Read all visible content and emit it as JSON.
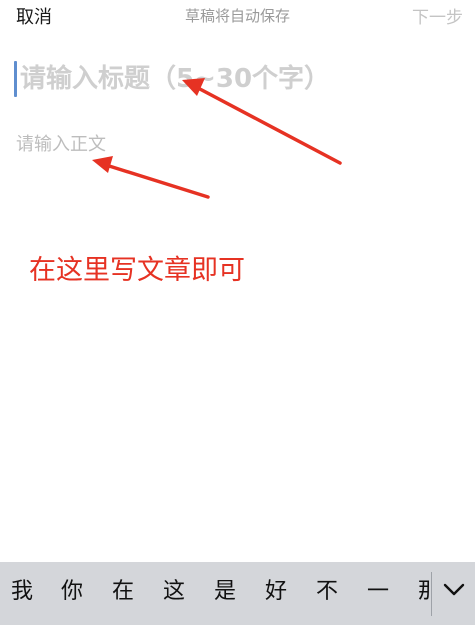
{
  "navbar": {
    "cancel_label": "取消",
    "status_text": "草稿将自动保存",
    "next_label": "下一步"
  },
  "editor": {
    "title_placeholder": "请输入标题（5~30个字）",
    "body_placeholder": "请输入正文"
  },
  "annotation": {
    "text": "在这里写文章即可",
    "color": "#e63223"
  },
  "keyboard": {
    "candidates": [
      "我",
      "你",
      "在",
      "这",
      "是",
      "好",
      "不",
      "一",
      "那"
    ],
    "collapse_icon": "chevron-down-icon",
    "bar_color": "#d4d6da"
  },
  "colors": {
    "caret": "#5f8ecf",
    "placeholder": "#cfcfcf",
    "next_disabled": "#c4c4c4"
  }
}
